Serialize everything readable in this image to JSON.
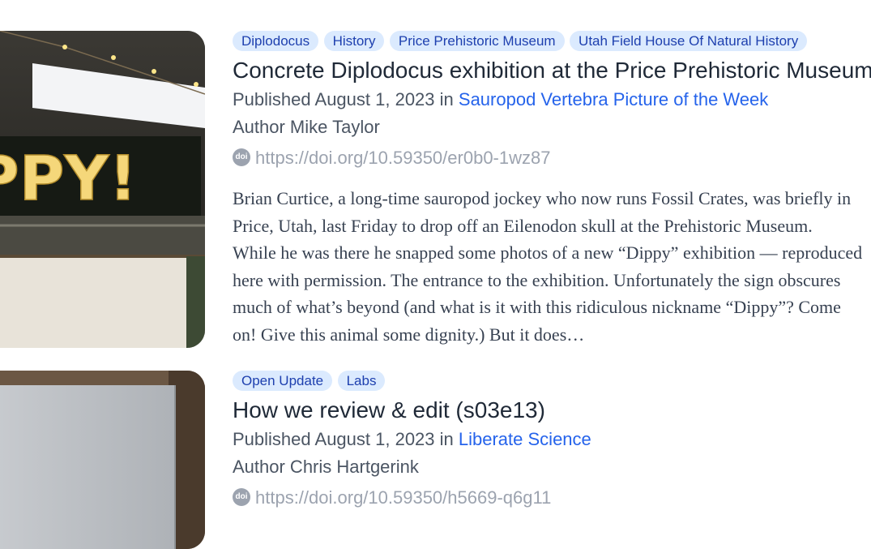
{
  "posts": [
    {
      "tags": [
        "Diplodocus",
        "History",
        "Price Prehistoric Museum",
        "Utah Field House Of Natural History"
      ],
      "title": "Concrete Diplodocus exhibition at the Price Prehistoric Museum",
      "published_prefix": "Published August 1, 2023 in",
      "blog": "Sauropod Vertebra Picture of the Week",
      "author": "Author Mike Taylor",
      "doi_icon": "doi",
      "doi": "https://doi.org/10.59350/er0b0-1wz87",
      "image_sign_text": "PPY!",
      "excerpt_lines": [
        "Brian Curtice, a long-time sauropod jockey who now runs Fossil Crates, was briefly in",
        "Price, Utah, last Friday to drop off an Eilenodon skull at the Prehistoric Museum.",
        "While he was there he snapped some photos of a new “Dippy” exhibition — reproduced",
        "here with permission. The entrance to the exhibition. Unfortunately the sign obscures",
        "much of what’s beyond (and what is it with this ridiculous nickname “Dippy”? Come",
        "on! Give this animal some dignity.) But it does…"
      ]
    },
    {
      "tags": [
        "Open Update",
        "Labs"
      ],
      "title": "How we review & edit (s03e13)",
      "published_prefix": "Published August 1, 2023 in",
      "blog": "Liberate Science",
      "author": "Author Chris Hartgerink",
      "doi_icon": "doi",
      "doi": "https://doi.org/10.59350/h5669-q6g11"
    }
  ]
}
